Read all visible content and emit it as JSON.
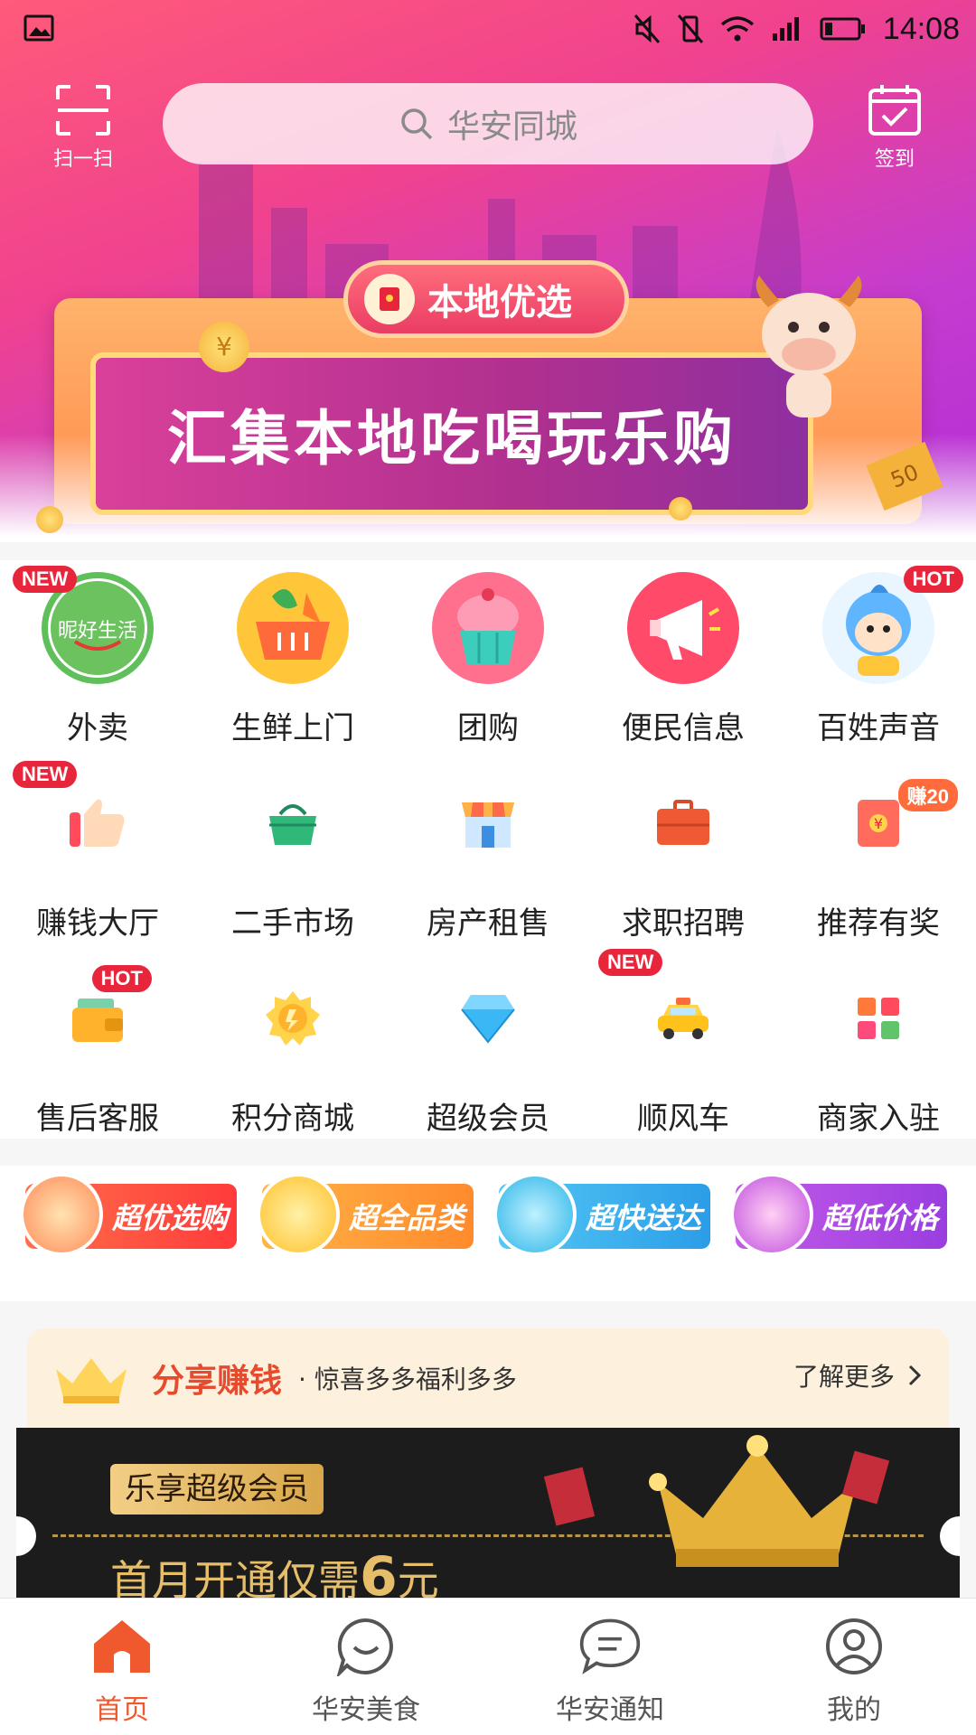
{
  "status_bar": {
    "time": "14:08"
  },
  "header": {
    "scan_label": "扫一扫",
    "search_placeholder": "华安同城",
    "checkin_label": "签到"
  },
  "banner": {
    "tag": "本地优选",
    "headline": "汇集本地吃喝玩乐购",
    "coin_left": "¥",
    "coupon_value": "50"
  },
  "grid": [
    {
      "label": "外卖",
      "badge": "NEW",
      "logo_text": "昵好生活",
      "icon": "nihao-life-logo-icon"
    },
    {
      "label": "生鲜上门",
      "badge": "",
      "icon": "vegetable-basket-icon"
    },
    {
      "label": "团购",
      "badge": "",
      "icon": "cupcake-icon"
    },
    {
      "label": "便民信息",
      "badge": "",
      "icon": "megaphone-icon"
    },
    {
      "label": "百姓声音",
      "badge": "HOT",
      "icon": "mascot-icon"
    },
    {
      "label": "赚钱大厅",
      "badge": "NEW",
      "icon": "thumbs-up-icon"
    },
    {
      "label": "二手市场",
      "badge": "",
      "icon": "basket-icon"
    },
    {
      "label": "房产租售",
      "badge": "",
      "icon": "storefront-icon"
    },
    {
      "label": "求职招聘",
      "badge": "",
      "icon": "briefcase-icon"
    },
    {
      "label": "推荐有奖",
      "badge": "赚20",
      "icon": "red-envelope-icon"
    },
    {
      "label": "售后客服",
      "badge": "HOT",
      "icon": "wallet-icon"
    },
    {
      "label": "积分商城",
      "badge": "",
      "icon": "gold-coin-icon"
    },
    {
      "label": "超级会员",
      "badge": "",
      "icon": "diamond-icon"
    },
    {
      "label": "顺风车",
      "badge": "NEW",
      "icon": "taxi-icon"
    },
    {
      "label": "商家入驻",
      "badge": "",
      "icon": "app-grid-icon"
    }
  ],
  "features": [
    {
      "label": "超优选购"
    },
    {
      "label": "超全品类"
    },
    {
      "label": "超快送达"
    },
    {
      "label": "超低价格"
    }
  ],
  "share": {
    "title": "分享赚钱",
    "subtitle": "· 惊喜多多福利多多",
    "more": "了解更多"
  },
  "promo": {
    "tag": "乐享超级会员",
    "line_prefix": "首月开通仅需",
    "line_number": "6",
    "line_suffix": "元"
  },
  "nav": [
    {
      "label": "首页",
      "active": true
    },
    {
      "label": "华安美食",
      "active": false
    },
    {
      "label": "华安通知",
      "active": false
    },
    {
      "label": "我的",
      "active": false
    }
  ],
  "colors": {
    "accent": "#f0592e",
    "badge_red": "#e8263b",
    "hero_start": "#ff5a7a",
    "hero_end": "#b52cd6"
  }
}
